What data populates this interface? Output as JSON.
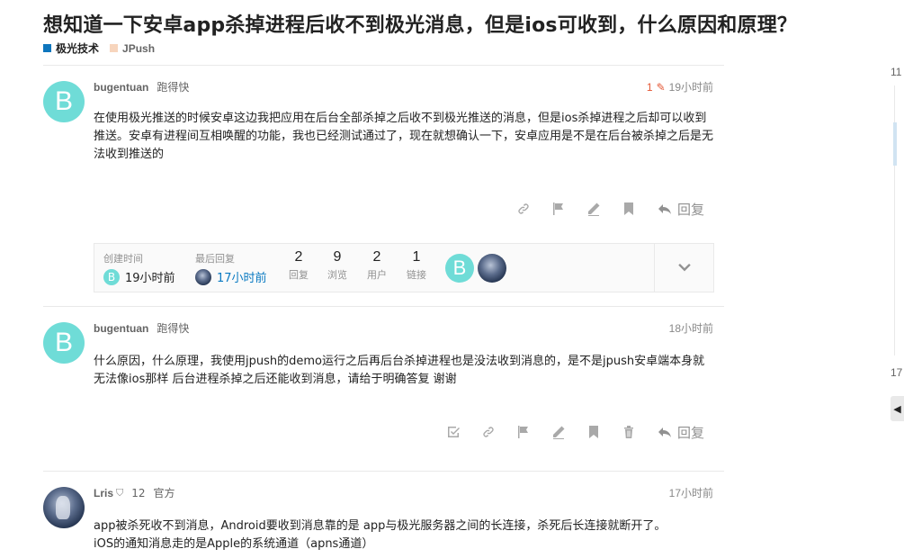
{
  "topic": {
    "title": "想知道一下安卓app杀掉进程后收不到极光消息，但是ios可收到，什么原因和原理？",
    "categories": [
      {
        "label": "极光技术",
        "color": "#0e76bd"
      },
      {
        "label": "JPush",
        "color": "#f7d5bd"
      }
    ]
  },
  "posts": [
    {
      "avatar_letter": "B",
      "username": "bugentuan",
      "fullname": "跑得快",
      "edit_count": "1",
      "time": "19小时前",
      "body": "在使用极光推送的时候安卓这边我把应用在后台全部杀掉之后收不到极光推送的消息，但是ios杀掉进程之后却可以收到推送。安卓有进程间互相唤醒的功能，我也已经测试通过了，现在就想确认一下，安卓应用是不是在后台被杀掉之后是无法收到推送的",
      "reply_label": "回复"
    },
    {
      "avatar_letter": "B",
      "username": "bugentuan",
      "fullname": "跑得快",
      "time": "18小时前",
      "body": "什么原因，什么原理，我使用jpush的demo运行之后再后台杀掉进程也是没法收到消息的，是不是jpush安卓端本身就无法像ios那样 后台进程杀掉之后还能收到消息，请给于明确答复 谢谢",
      "reply_label": "回复"
    },
    {
      "username": "Lris",
      "trust_level": "12",
      "title": "官方",
      "time": "17小时前",
      "body_lines": [
        "app被杀死收不到消息，Android要收到消息靠的是 app与极光服务器之间的长连接，杀死后长连接就断开了。",
        "iOS的通知消息走的是Apple的系统通道（apns通道）"
      ]
    }
  ],
  "summary": {
    "created_label": "创建时间",
    "created_time": "19小时前",
    "created_avatar_letter": "B",
    "last_reply_label": "最后回复",
    "last_reply_time": "17小时前",
    "stats": [
      {
        "value": "2",
        "label": "回复"
      },
      {
        "value": "9",
        "label": "浏览"
      },
      {
        "value": "2",
        "label": "用户"
      },
      {
        "value": "1",
        "label": "链接"
      }
    ],
    "participant_letter": "B"
  },
  "timeline": {
    "top_label": "11",
    "bottom_label": "17"
  },
  "colors": {
    "accent": "#0a7ac2",
    "avatar_teal": "#6fdcd7",
    "edit_orange": "#e45735"
  }
}
